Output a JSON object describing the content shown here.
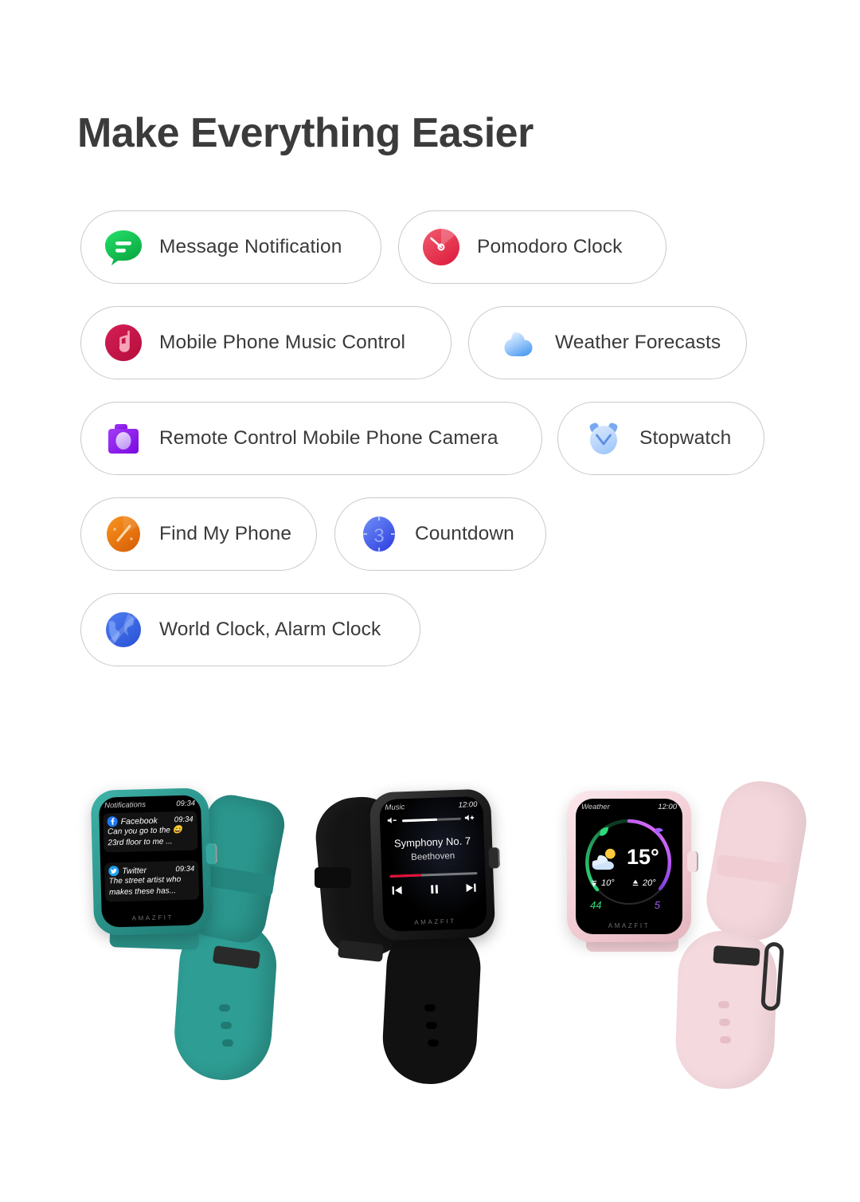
{
  "page": {
    "heading": "Make Everything Easier",
    "background": "#ffffff",
    "heading_color": "#3b3b3b"
  },
  "features": [
    {
      "label": "Message Notification",
      "icon": "message-bubble-icon",
      "color": "#19c252",
      "row": 1,
      "col": 1
    },
    {
      "label": "Pomodoro Clock",
      "icon": "pomodoro-timer-icon",
      "color": "#e8344e",
      "row": 1,
      "col": 2
    },
    {
      "label": "Mobile Phone Music Control",
      "icon": "music-note-icon",
      "color": "#c9174a",
      "row": 2,
      "col": 1
    },
    {
      "label": "Weather Forecasts",
      "icon": "cloud-icon",
      "color": "#76b4f5",
      "row": 2,
      "col": 2
    },
    {
      "label": "Remote Control Mobile Phone Camera",
      "icon": "camera-icon",
      "color": "#8a1ef0",
      "row": 3,
      "col": 1
    },
    {
      "label": "Stopwatch",
      "icon": "alarm-clock-icon",
      "color": "#a9cdf8",
      "row": 3,
      "col": 2
    },
    {
      "label": "Find My Phone",
      "icon": "find-phone-icon",
      "color": "#ef7b11",
      "row": 4,
      "col": 1
    },
    {
      "label": "Countdown",
      "icon": "countdown-icon",
      "color": "#4a6ef0",
      "row": 4,
      "col": 2,
      "badge": "3"
    },
    {
      "label": "World Clock, Alarm Clock",
      "icon": "globe-icon",
      "color": "#3566e8",
      "row": 5,
      "col": 1
    }
  ],
  "watches": [
    {
      "name": "notifications-watch",
      "color_name": "green",
      "case_color": "#2e9d93",
      "band_color": "#2a8f86",
      "brand": "AMAZFIT",
      "screen": {
        "app_title": "Notifications",
        "time": "09:34",
        "notifications": [
          {
            "app": "Facebook",
            "app_color": "#1877f2",
            "time": "09:34",
            "line1": "Can you go to the 😄",
            "line2": "23rd floor to me ..."
          },
          {
            "app": "Twitter",
            "app_color": "#1da1f2",
            "time": "09:34",
            "line1": "The street artist who",
            "line2": "makes these has..."
          }
        ]
      }
    },
    {
      "name": "music-watch",
      "color_name": "black",
      "case_color": "#1c1c1c",
      "band_color": "#141414",
      "brand": "AMAZFIT",
      "screen": {
        "app_title": "Music",
        "time": "12:00",
        "track_title": "Symphony No. 7",
        "artist": "Beethoven",
        "volume_percent": 60,
        "progress_percent": 36,
        "progress_color": "#e5113a",
        "controls": [
          "previous-track",
          "pause",
          "next-track"
        ]
      }
    },
    {
      "name": "weather-watch",
      "color_name": "pink",
      "case_color": "#f2cbd3",
      "band_color": "#f6dbe0",
      "brand": "AMAZFIT",
      "screen": {
        "app_title": "Weather",
        "time": "12:00",
        "temperature": "15°",
        "low": "10°",
        "high": "20°",
        "left_arc_value": "44",
        "left_arc_color": "#2fd97a",
        "left_arc_icon": "leaf-icon",
        "right_arc_value": "5",
        "right_arc_color": "#a15cf7",
        "right_arc_icon": "umbrella-icon",
        "condition_icon": "sun-behind-cloud-icon"
      }
    }
  ]
}
